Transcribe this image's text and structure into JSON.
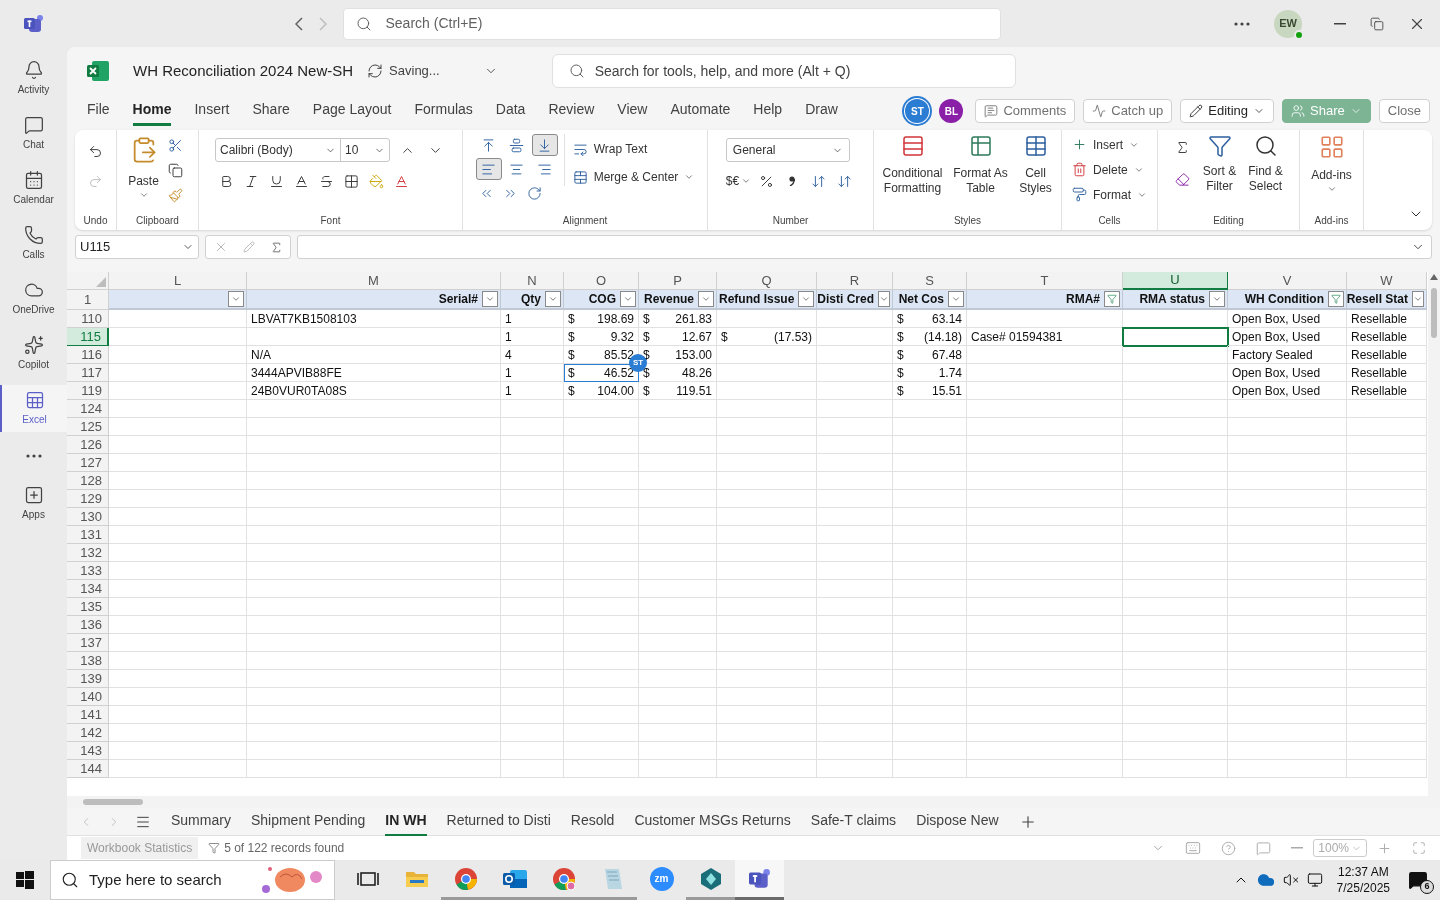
{
  "teams_bar": {
    "search_placeholder": "Search (Ctrl+E)",
    "user_initials": "EW"
  },
  "rail_items": [
    {
      "label": "Activity",
      "selected": false
    },
    {
      "label": "Chat",
      "selected": false
    },
    {
      "label": "Calendar",
      "selected": false
    },
    {
      "label": "Calls",
      "selected": false
    },
    {
      "label": "OneDrive",
      "selected": false
    },
    {
      "label": "Copilot",
      "selected": false
    },
    {
      "label": "Excel",
      "selected": true
    }
  ],
  "rail_footer": {
    "label": "Apps"
  },
  "workbook": {
    "title": "WH Reconciliation 2024 New-SH",
    "save_status": "Saving...",
    "search_placeholder": "Search for tools, help, and more (Alt + Q)"
  },
  "menu_tabs": [
    {
      "label": "File",
      "selected": false
    },
    {
      "label": "Home",
      "selected": true
    },
    {
      "label": "Insert",
      "selected": false
    },
    {
      "label": "Share",
      "selected": false
    },
    {
      "label": "Page Layout",
      "selected": false
    },
    {
      "label": "Formulas",
      "selected": false
    },
    {
      "label": "Data",
      "selected": false
    },
    {
      "label": "Review",
      "selected": false
    },
    {
      "label": "View",
      "selected": false
    },
    {
      "label": "Automate",
      "selected": false
    },
    {
      "label": "Help",
      "selected": false
    },
    {
      "label": "Draw",
      "selected": false
    }
  ],
  "collaborators": [
    {
      "initials": "ST",
      "color": "#2b7cd3"
    },
    {
      "initials": "BL",
      "color": "#8a1fa8"
    }
  ],
  "actions": [
    {
      "label": "Comments",
      "kind": "comments"
    },
    {
      "label": "Catch up",
      "kind": "catchup"
    },
    {
      "label": "Editing",
      "kind": "editing"
    },
    {
      "label": "Share",
      "kind": "share"
    },
    {
      "label": "Close",
      "kind": "close"
    }
  ],
  "ribbon": {
    "undo": {
      "group": "Undo"
    },
    "clipboard": {
      "group": "Clipboard",
      "paste": "Paste"
    },
    "font": {
      "group": "Font",
      "font_name": "Calibri (Body)",
      "font_size": "10"
    },
    "alignment": {
      "group": "Alignment",
      "vertical_buttons": [
        {
          "selected": false
        },
        {
          "selected": false
        },
        {
          "selected": true
        }
      ],
      "horizontal_buttons": [
        {
          "selected": true
        },
        {
          "selected": false
        },
        {
          "selected": false
        }
      ],
      "wrap": "Wrap Text",
      "merge": "Merge & Center"
    },
    "number": {
      "group": "Number",
      "format": "General",
      "currency": "$€"
    },
    "styles": {
      "group": "Styles",
      "buttons": [
        "Conditional Formatting",
        "Format As Table",
        "Cell Styles"
      ]
    },
    "cells": {
      "group": "Cells",
      "buttons": [
        "Insert",
        "Delete",
        "Format"
      ]
    },
    "editing": {
      "group": "Editing",
      "buttons": [
        "Sort & Filter",
        "Find & Select"
      ]
    },
    "addins": {
      "group": "Add-ins",
      "button": "Add-ins"
    }
  },
  "formula_bar": {
    "name_box": "U115"
  },
  "sheet": {
    "columns": [
      {
        "letter": "L",
        "filtered": false,
        "selected": false
      },
      {
        "letter": "M",
        "header": "Serial#",
        "filtered": false,
        "selected": false
      },
      {
        "letter": "N",
        "header": "Qty",
        "filtered": false,
        "selected": false
      },
      {
        "letter": "O",
        "header": "COG",
        "filtered": false,
        "selected": false
      },
      {
        "letter": "P",
        "header": "Revenue",
        "filtered": false,
        "selected": false
      },
      {
        "letter": "Q",
        "header": "Refund Issue",
        "filtered": false,
        "selected": false
      },
      {
        "letter": "R",
        "header": "Disti Cred",
        "filtered": false,
        "selected": false
      },
      {
        "letter": "S",
        "header": "Net Cos",
        "filtered": false,
        "selected": false
      },
      {
        "letter": "T",
        "header": "RMA#",
        "filtered": true,
        "selected": false
      },
      {
        "letter": "U",
        "header": "RMA status",
        "filtered": false,
        "selected": true
      },
      {
        "letter": "V",
        "header": "WH Condition",
        "filtered": true,
        "selected": false
      },
      {
        "letter": "W",
        "header": "Resell Stat",
        "filtered": false,
        "selected": false
      }
    ],
    "header_row": "1",
    "rows": [
      {
        "number": "110",
        "selected": false,
        "cells": [
          null,
          {
            "kind": "text",
            "value": "LBVAT7KB1508103"
          },
          {
            "kind": "text",
            "value": "1"
          },
          {
            "kind": "currency",
            "symbol": "$",
            "amount": "198.69"
          },
          {
            "kind": "currency",
            "symbol": "$",
            "amount": "261.83"
          },
          null,
          null,
          {
            "kind": "currency",
            "symbol": "$",
            "amount": "63.14"
          },
          null,
          null,
          {
            "kind": "text",
            "value": "Open Box, Used"
          },
          {
            "kind": "text",
            "value": "Resellable"
          }
        ]
      },
      {
        "number": "115",
        "selected": true,
        "cells": [
          null,
          null,
          {
            "kind": "text",
            "value": "1"
          },
          {
            "kind": "currency",
            "symbol": "$",
            "amount": "9.32"
          },
          {
            "kind": "currency",
            "symbol": "$",
            "amount": "12.67"
          },
          {
            "kind": "currency",
            "symbol": "$",
            "amount": "(17.53)"
          },
          null,
          {
            "kind": "currency",
            "symbol": "$",
            "amount": "(14.18)"
          },
          {
            "kind": "text",
            "value": "Case# 01594381"
          },
          null,
          {
            "kind": "text",
            "value": "Open Box, Used"
          },
          {
            "kind": "text",
            "value": "Resellable"
          }
        ]
      },
      {
        "number": "116",
        "selected": false,
        "cells": [
          null,
          {
            "kind": "text",
            "value": "N/A"
          },
          {
            "kind": "text",
            "value": "4"
          },
          {
            "kind": "currency",
            "symbol": "$",
            "amount": "85.52"
          },
          {
            "kind": "currency",
            "symbol": "$",
            "amount": "153.00"
          },
          null,
          null,
          {
            "kind": "currency",
            "symbol": "$",
            "amount": "67.48"
          },
          null,
          null,
          {
            "kind": "text",
            "value": "Factory Sealed"
          },
          {
            "kind": "text",
            "value": "Resellable"
          }
        ]
      },
      {
        "number": "117",
        "selected": false,
        "cells": [
          null,
          {
            "kind": "text",
            "value": "3444APVIB88FE"
          },
          {
            "kind": "text",
            "value": "1"
          },
          {
            "kind": "currency",
            "symbol": "$",
            "amount": "46.52",
            "presence": "ST"
          },
          {
            "kind": "currency",
            "symbol": "$",
            "amount": "48.26"
          },
          null,
          null,
          {
            "kind": "currency",
            "symbol": "$",
            "amount": "1.74"
          },
          null,
          null,
          {
            "kind": "text",
            "value": "Open Box, Used"
          },
          {
            "kind": "text",
            "value": "Resellable"
          }
        ]
      },
      {
        "number": "119",
        "selected": false,
        "cells": [
          null,
          {
            "kind": "text",
            "value": "24B0VUR0TA08S"
          },
          {
            "kind": "text",
            "value": "1"
          },
          {
            "kind": "currency",
            "symbol": "$",
            "amount": "104.00"
          },
          {
            "kind": "currency",
            "symbol": "$",
            "amount": "119.51"
          },
          null,
          null,
          {
            "kind": "currency",
            "symbol": "$",
            "amount": "15.51"
          },
          null,
          null,
          {
            "kind": "text",
            "value": "Open Box, Used"
          },
          {
            "kind": "text",
            "value": "Resellable"
          }
        ]
      },
      {
        "number": "124",
        "selected": false
      },
      {
        "number": "125",
        "selected": false
      },
      {
        "number": "126",
        "selected": false
      },
      {
        "number": "127",
        "selected": false
      },
      {
        "number": "128",
        "selected": false
      },
      {
        "number": "129",
        "selected": false
      },
      {
        "number": "130",
        "selected": false
      },
      {
        "number": "131",
        "selected": false
      },
      {
        "number": "132",
        "selected": false
      },
      {
        "number": "133",
        "selected": false
      },
      {
        "number": "134",
        "selected": false
      },
      {
        "number": "135",
        "selected": false
      },
      {
        "number": "136",
        "selected": false
      },
      {
        "number": "137",
        "selected": false
      },
      {
        "number": "138",
        "selected": false
      },
      {
        "number": "139",
        "selected": false
      },
      {
        "number": "140",
        "selected": false
      },
      {
        "number": "141",
        "selected": false
      },
      {
        "number": "142",
        "selected": false
      },
      {
        "number": "143",
        "selected": false
      },
      {
        "number": "144",
        "selected": false
      }
    ]
  },
  "sheet_tabs": [
    {
      "label": "Summary",
      "selected": false
    },
    {
      "label": "Shipment Pending",
      "selected": false
    },
    {
      "label": "IN WH",
      "selected": true
    },
    {
      "label": "Returned to Disti",
      "selected": false
    },
    {
      "label": "Resold",
      "selected": false
    },
    {
      "label": "Customer MSGs Returns",
      "selected": false
    },
    {
      "label": "Safe-T claims",
      "selected": false
    },
    {
      "label": "Dispose New",
      "selected": false
    }
  ],
  "status_bar": {
    "stats": "Workbook Statistics",
    "filter_status": "5 of 122 records found",
    "zoom": "100%"
  },
  "taskbar": {
    "search_placeholder": "Type here to search",
    "time": "12:37 AM",
    "date": "7/25/2025",
    "notifications": "6",
    "apps": [
      {
        "kind": "taskview",
        "running": false,
        "selected": false
      },
      {
        "kind": "explorer",
        "running": false,
        "selected": false
      },
      {
        "kind": "chrome",
        "running": true,
        "selected": false
      },
      {
        "kind": "outlook",
        "running": true,
        "selected": false
      },
      {
        "kind": "chrome_profile",
        "running": true,
        "selected": false
      },
      {
        "kind": "notepad",
        "running": true,
        "selected": false
      },
      {
        "kind": "zoom",
        "label": "zm",
        "running": false,
        "selected": false
      },
      {
        "kind": "app",
        "running": true,
        "selected": false
      },
      {
        "kind": "teams",
        "running": true,
        "selected": true
      }
    ]
  }
}
